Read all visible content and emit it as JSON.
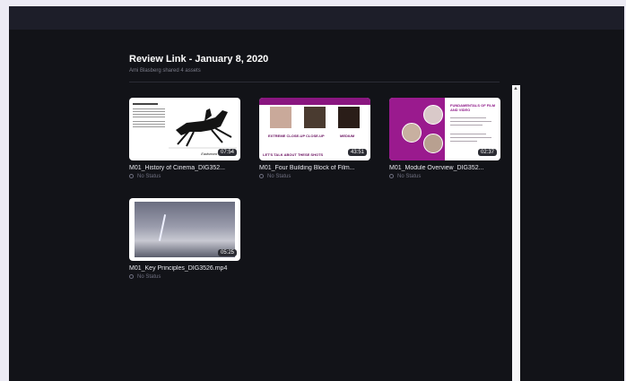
{
  "review": {
    "title": "Review Link - January 8, 2020",
    "subtitle": "Ami Blasberg shared 4 assets"
  },
  "assets": [
    {
      "title": "M01_History of Cinema_DIG352...",
      "duration": "07:54",
      "status": "No Status",
      "thumb_caption": "Eadweard Muybridge"
    },
    {
      "title": "M01_Four Building Block of Film...",
      "duration": "43:51",
      "status": "No Status",
      "thumb_labels": [
        "EXTREME CLOSE-UP",
        "CLOSE-UP",
        "MEDIUM"
      ],
      "thumb_footer": "LET'S TALK ABOUT THESE SHOTS"
    },
    {
      "title": "M01_Module Overview_DIG352...",
      "duration": "02:37",
      "status": "No Status",
      "thumb_heading": "FUNDAMENTALS OF FILM AND VIDEO"
    },
    {
      "title": "M01_Key Principles_DIG3526.mp4",
      "duration": "05:25",
      "status": "No Status"
    }
  ],
  "colors": {
    "background": "#121318",
    "topbar": "#1d1e29",
    "accent": "#8a1680"
  }
}
